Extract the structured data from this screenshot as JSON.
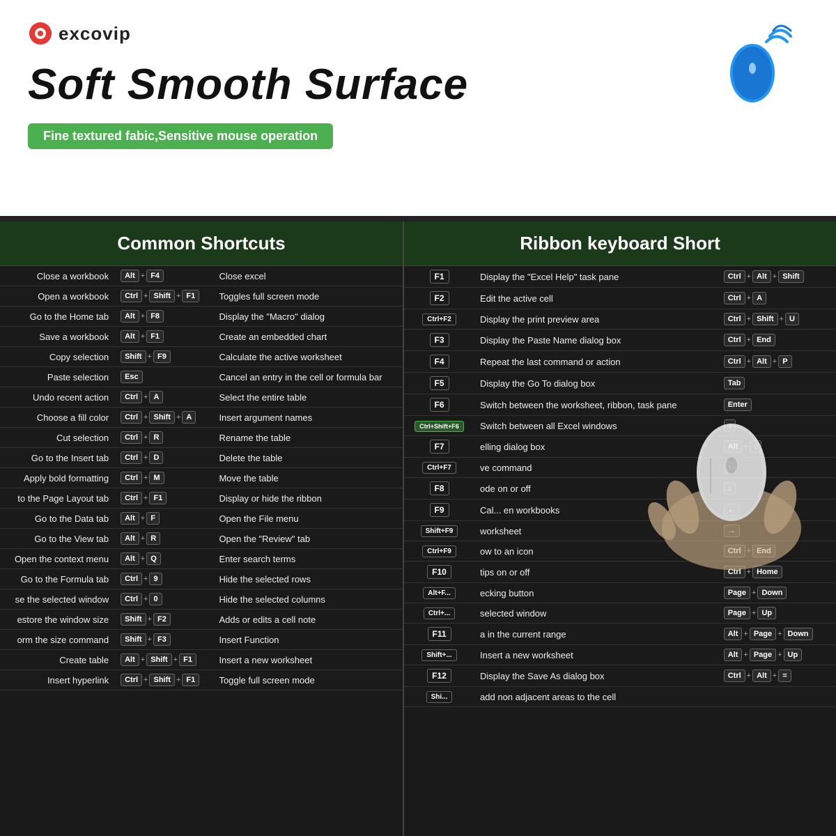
{
  "brand": {
    "name": "excovip"
  },
  "header": {
    "title": "Soft Smooth Surface",
    "subtitle": "Fine textured fabic,Sensitive mouse operation"
  },
  "left_col_header": "Common Shortcuts",
  "right_col_header": "Ribbon keyboard Short",
  "left_shortcuts": [
    {
      "action": "Close a workbook",
      "keys": [
        [
          "Alt",
          "F4"
        ]
      ]
    },
    {
      "action": "Open a workbook",
      "keys": [
        [
          "Ctrl",
          "Shift",
          "F1"
        ]
      ]
    },
    {
      "action": "Go to the Home tab",
      "keys": [
        [
          "Alt",
          "F8"
        ]
      ]
    },
    {
      "action": "Save a workbook",
      "keys": [
        [
          "Alt",
          "F1"
        ]
      ]
    },
    {
      "action": "Copy selection",
      "keys": [
        [
          "Shift",
          "F9"
        ]
      ]
    },
    {
      "action": "Paste selection",
      "keys": [
        [
          "Esc"
        ]
      ]
    },
    {
      "action": "Undo recent action",
      "keys": [
        [
          "Ctrl",
          "A"
        ]
      ]
    },
    {
      "action": "Choose a fill color",
      "keys": [
        [
          "Ctrl",
          "Shift",
          "A"
        ]
      ]
    },
    {
      "action": "Cut selection",
      "keys": [
        [
          "Ctrl",
          "R"
        ]
      ]
    },
    {
      "action": "Go to the Insert tab",
      "keys": [
        [
          "Ctrl",
          "D"
        ]
      ]
    },
    {
      "action": "Apply bold formatting",
      "keys": [
        [
          "Ctrl",
          "M"
        ]
      ]
    },
    {
      "action": "to the Page Layout tab",
      "keys": [
        [
          "Ctrl",
          "F1"
        ]
      ]
    },
    {
      "action": "Go to the Data tab",
      "keys": [
        [
          "Alt",
          "F"
        ]
      ]
    },
    {
      "action": "Go to the View tab",
      "keys": [
        [
          "Alt",
          "R"
        ]
      ]
    },
    {
      "action": "Open the context menu",
      "keys": [
        [
          "Alt",
          "Q"
        ]
      ]
    },
    {
      "action": "Go to the Formula tab",
      "keys": [
        [
          "Ctrl",
          "9"
        ]
      ]
    },
    {
      "action": "se the selected window",
      "keys": [
        [
          "Ctrl",
          "0"
        ]
      ]
    },
    {
      "action": "estore the window size",
      "keys": [
        [
          "Shift",
          "F2"
        ]
      ]
    },
    {
      "action": "orm the size command",
      "keys": [
        [
          "Shift",
          "F3"
        ]
      ]
    },
    {
      "action": "Create table",
      "keys": [
        [
          "Alt",
          "Shift",
          "F1"
        ]
      ]
    },
    {
      "action": "Insert hyperlink",
      "keys": [
        [
          "Ctrl",
          "Shift",
          "F1"
        ]
      ]
    }
  ],
  "left_shortcuts_right": [
    {
      "action": "Close excel",
      "keys": []
    },
    {
      "action": "Toggles full screen mode",
      "keys": []
    },
    {
      "action": "Display the \"Macro\" dialog",
      "keys": []
    },
    {
      "action": "Create an embedded chart",
      "keys": []
    },
    {
      "action": "Calculate the active worksheet",
      "keys": []
    },
    {
      "action": "Cancel an entry in the cell or formula bar",
      "keys": []
    },
    {
      "action": "Select the entire table",
      "keys": []
    },
    {
      "action": "Insert argument names",
      "keys": []
    },
    {
      "action": "Rename the table",
      "keys": []
    },
    {
      "action": "Delete the table",
      "keys": []
    },
    {
      "action": "Move the table",
      "keys": []
    },
    {
      "action": "Display or hide the ribbon",
      "keys": []
    },
    {
      "action": "Open the File menu",
      "keys": []
    },
    {
      "action": "Open the \"Review\" tab",
      "keys": []
    },
    {
      "action": "Enter search terms",
      "keys": []
    },
    {
      "action": "Hide the selected rows",
      "keys": []
    },
    {
      "action": "Hide the selected columns",
      "keys": []
    },
    {
      "action": "Adds or edits a cell note",
      "keys": []
    },
    {
      "action": "Insert Function",
      "keys": []
    },
    {
      "action": "Insert a new worksheet",
      "keys": []
    },
    {
      "action": "Toggle full screen mode",
      "keys": []
    }
  ],
  "right_shortcuts": [
    {
      "fkey": "F1",
      "action": "Display the \"Excel Help\" task pane",
      "keys": "Ctrl+Alt+Shift"
    },
    {
      "fkey": "F2",
      "action": "Edit the active cell",
      "keys": "Ctrl+A"
    },
    {
      "fkey": "Ctrl+F2",
      "action": "Display the print preview area",
      "keys": "Ctrl+Shift+U"
    },
    {
      "fkey": "F3",
      "action": "Display the Paste Name dialog box",
      "keys": "Ctrl+End"
    },
    {
      "fkey": "F4",
      "action": "Repeat the last command or action",
      "keys": "Ctrl+Alt+P"
    },
    {
      "fkey": "F5",
      "action": "Display the Go To dialog box",
      "keys": "Tab"
    },
    {
      "fkey": "F6",
      "action": "Switch between the worksheet, ribbon, task pane",
      "keys": "Enter"
    },
    {
      "fkey": "Ctrl+Shift+F6",
      "action": "Switch between all Excel windows",
      "keys": "↓"
    },
    {
      "fkey": "F7",
      "action": "elling dialog box",
      "keys": "Alt+↓"
    },
    {
      "fkey": "Ctrl+F7",
      "action": "ve command",
      "keys": "↑"
    },
    {
      "fkey": "F8",
      "action": "ode on or off",
      "keys": "↓"
    },
    {
      "fkey": "F9",
      "action": "Cal... en workbooks",
      "keys": "←"
    },
    {
      "fkey": "Shift+F9",
      "action": "worksheet",
      "keys": "→"
    },
    {
      "fkey": "Ctrl+F9",
      "action": "ow to an icon",
      "keys": "Ctrl+End"
    },
    {
      "fkey": "F10",
      "action": "tips on or off",
      "keys": "Ctrl+Home"
    },
    {
      "fkey": "Alt+F...",
      "action": "ecking button",
      "keys": "Page+Down"
    },
    {
      "fkey": "Ctrl+...",
      "action": "selected window",
      "keys": "Page+Up"
    },
    {
      "fkey": "F11",
      "action": "a in the current range",
      "keys": "Alt+Page+Down"
    },
    {
      "fkey": "Shift+...",
      "action": "Insert a new worksheet",
      "keys": "Alt+Page+Up"
    },
    {
      "fkey": "F12",
      "action": "Display the Save As dialog box",
      "keys": "Ctrl+Alt+="
    },
    {
      "fkey": "Shi...",
      "action": "add non adjacent areas to the cell",
      "keys": ""
    }
  ]
}
